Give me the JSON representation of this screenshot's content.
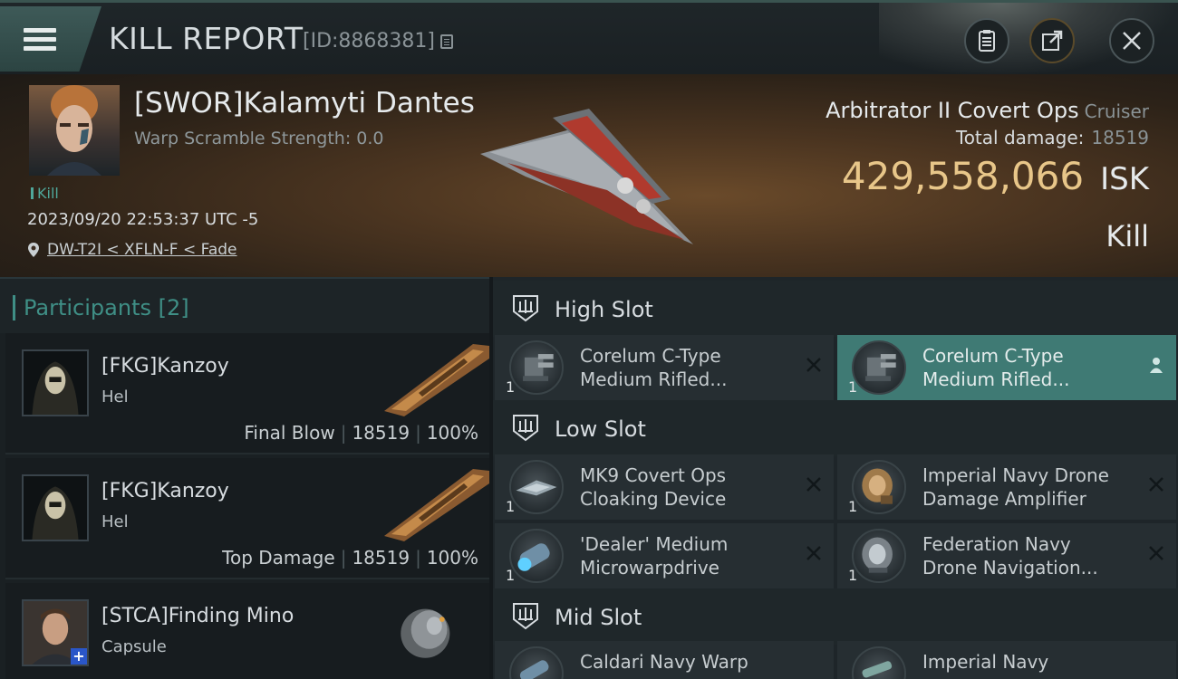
{
  "header": {
    "title": "KILL REPORT",
    "id_label": "[ID:8868381]"
  },
  "victim": {
    "name": "[SWOR]Kalamyti Dantes",
    "warp_scramble": "Warp Scramble Strength: 0.0",
    "tag": "Kill",
    "datetime": "2023/09/20 22:53:37 UTC -5",
    "location": "DW-T2I < XFLN-F < Fade",
    "ship_name": "Arbitrator II Covert Ops",
    "ship_class": "Cruiser",
    "total_damage_label": "Total damage:",
    "total_damage": "18519",
    "isk_value": "429,558,066",
    "isk_unit": "ISK",
    "result": "Kill"
  },
  "participants": {
    "header_label": "Participants",
    "count": "[2]",
    "rows": [
      {
        "name": "[FKG]Kanzoy",
        "ship": "Hel",
        "role": "Final Blow",
        "damage": "18519",
        "percent": "100%"
      },
      {
        "name": "[FKG]Kanzoy",
        "ship": "Hel",
        "role": "Top Damage",
        "damage": "18519",
        "percent": "100%"
      },
      {
        "name": "[STCA]Finding Mino",
        "ship": "Capsule"
      }
    ]
  },
  "fitting": {
    "high_slot": {
      "label": "High Slot",
      "modules": [
        {
          "qty": "1",
          "name_line1": "Corelum C-Type",
          "name_line2": "Medium Rifled..."
        },
        {
          "qty": "1",
          "name_line1": "Corelum C-Type",
          "name_line2": "Medium Rifled..."
        }
      ]
    },
    "low_slot": {
      "label": "Low Slot",
      "modules": [
        {
          "qty": "1",
          "name_line1": "MK9 Covert Ops",
          "name_line2": "Cloaking Device"
        },
        {
          "qty": "1",
          "name_line1": "Imperial Navy Drone",
          "name_line2": "Damage Amplifier"
        },
        {
          "qty": "1",
          "name_line1": "'Dealer' Medium",
          "name_line2": "Microwarpdrive"
        },
        {
          "qty": "1",
          "name_line1": "Federation Navy",
          "name_line2": "Drone Navigation..."
        }
      ]
    },
    "mid_slot": {
      "label": "Mid Slot",
      "modules": [
        {
          "name_line1": "Caldari Navy Warp"
        },
        {
          "name_line1": "Imperial Navy"
        }
      ]
    }
  },
  "colors": {
    "accent_teal": "#3f8f86",
    "isk_gold": "#e8c689",
    "selected_module": "#3f7a74"
  }
}
